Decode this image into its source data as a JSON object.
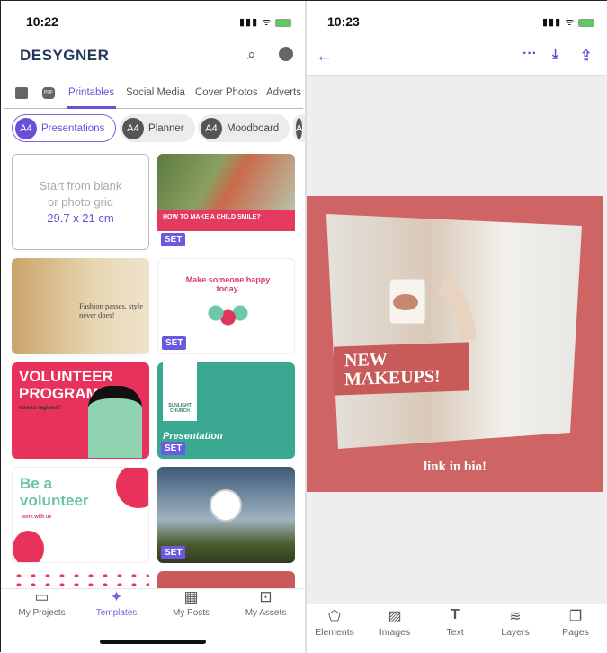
{
  "left": {
    "status_time": "10:22",
    "logo": "DESYGNER",
    "tabs": [
      "Printables",
      "Social Media",
      "Cover Photos",
      "Adverts"
    ],
    "active_tab": "Printables",
    "chips": [
      {
        "badge": "A4",
        "label": "Presentations"
      },
      {
        "badge": "A4",
        "label": "Planner"
      },
      {
        "badge": "A4",
        "label": "Moodboard"
      }
    ],
    "blank": {
      "line1": "Start from blank",
      "line2": "or photo grid",
      "size": "29.7 x 21 cm"
    },
    "templates": [
      {
        "text": "HOW TO MAKE A CHILD SMILE?",
        "badge": "SET"
      },
      {
        "text": "Fashion passes, style never does!",
        "highlight": "Fashion"
      },
      {
        "text": "Make someone happy today.",
        "badge": "SET"
      },
      {
        "text": "VOLUNTEER PROGRAM",
        "sub": "how to register?"
      },
      {
        "text": "Presentation",
        "sub": "SUNLIGHT CHURCH",
        "badge": "SET"
      },
      {
        "text": "Be a volunteer",
        "sub": "work with us"
      },
      {
        "badge": "SET"
      }
    ],
    "nav": [
      {
        "label": "My Projects",
        "icon": "folder-icon"
      },
      {
        "label": "Templates",
        "icon": "templates-icon"
      },
      {
        "label": "My Posts",
        "icon": "calendar-icon"
      },
      {
        "label": "My Assets",
        "icon": "briefcase-icon"
      }
    ],
    "active_nav": "Templates"
  },
  "right": {
    "status_time": "10:23",
    "canvas": {
      "headline": "NEW MAKEUPS!",
      "headline_l1": "NEW",
      "headline_l2": "MAKEUPS!",
      "footer": "link in bio!",
      "bg_color": "#cf6464"
    },
    "tools": [
      {
        "label": "Elements",
        "icon": "shapes-icon"
      },
      {
        "label": "Images",
        "icon": "image-icon"
      },
      {
        "label": "Text",
        "icon": "text-icon"
      },
      {
        "label": "Layers",
        "icon": "layers-icon"
      },
      {
        "label": "Pages",
        "icon": "pages-icon"
      }
    ]
  },
  "colors": {
    "accent": "#6a4fd8",
    "brand": "#243858"
  }
}
